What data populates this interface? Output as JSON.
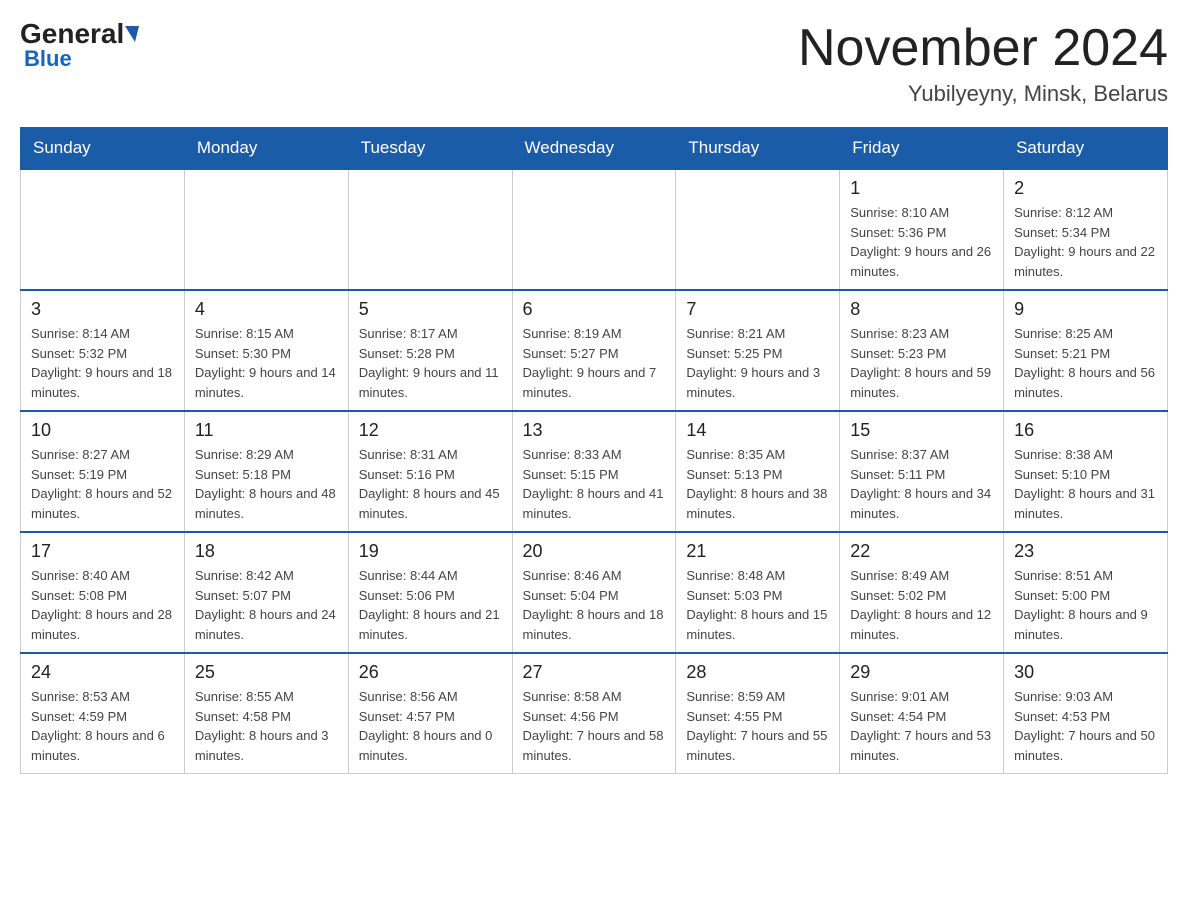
{
  "header": {
    "logo_general": "General",
    "logo_blue": "Blue",
    "month_title": "November 2024",
    "location": "Yubilyeyny, Minsk, Belarus"
  },
  "weekdays": [
    "Sunday",
    "Monday",
    "Tuesday",
    "Wednesday",
    "Thursday",
    "Friday",
    "Saturday"
  ],
  "weeks": [
    [
      {
        "day": "",
        "info": ""
      },
      {
        "day": "",
        "info": ""
      },
      {
        "day": "",
        "info": ""
      },
      {
        "day": "",
        "info": ""
      },
      {
        "day": "",
        "info": ""
      },
      {
        "day": "1",
        "info": "Sunrise: 8:10 AM\nSunset: 5:36 PM\nDaylight: 9 hours and 26 minutes."
      },
      {
        "day": "2",
        "info": "Sunrise: 8:12 AM\nSunset: 5:34 PM\nDaylight: 9 hours and 22 minutes."
      }
    ],
    [
      {
        "day": "3",
        "info": "Sunrise: 8:14 AM\nSunset: 5:32 PM\nDaylight: 9 hours and 18 minutes."
      },
      {
        "day": "4",
        "info": "Sunrise: 8:15 AM\nSunset: 5:30 PM\nDaylight: 9 hours and 14 minutes."
      },
      {
        "day": "5",
        "info": "Sunrise: 8:17 AM\nSunset: 5:28 PM\nDaylight: 9 hours and 11 minutes."
      },
      {
        "day": "6",
        "info": "Sunrise: 8:19 AM\nSunset: 5:27 PM\nDaylight: 9 hours and 7 minutes."
      },
      {
        "day": "7",
        "info": "Sunrise: 8:21 AM\nSunset: 5:25 PM\nDaylight: 9 hours and 3 minutes."
      },
      {
        "day": "8",
        "info": "Sunrise: 8:23 AM\nSunset: 5:23 PM\nDaylight: 8 hours and 59 minutes."
      },
      {
        "day": "9",
        "info": "Sunrise: 8:25 AM\nSunset: 5:21 PM\nDaylight: 8 hours and 56 minutes."
      }
    ],
    [
      {
        "day": "10",
        "info": "Sunrise: 8:27 AM\nSunset: 5:19 PM\nDaylight: 8 hours and 52 minutes."
      },
      {
        "day": "11",
        "info": "Sunrise: 8:29 AM\nSunset: 5:18 PM\nDaylight: 8 hours and 48 minutes."
      },
      {
        "day": "12",
        "info": "Sunrise: 8:31 AM\nSunset: 5:16 PM\nDaylight: 8 hours and 45 minutes."
      },
      {
        "day": "13",
        "info": "Sunrise: 8:33 AM\nSunset: 5:15 PM\nDaylight: 8 hours and 41 minutes."
      },
      {
        "day": "14",
        "info": "Sunrise: 8:35 AM\nSunset: 5:13 PM\nDaylight: 8 hours and 38 minutes."
      },
      {
        "day": "15",
        "info": "Sunrise: 8:37 AM\nSunset: 5:11 PM\nDaylight: 8 hours and 34 minutes."
      },
      {
        "day": "16",
        "info": "Sunrise: 8:38 AM\nSunset: 5:10 PM\nDaylight: 8 hours and 31 minutes."
      }
    ],
    [
      {
        "day": "17",
        "info": "Sunrise: 8:40 AM\nSunset: 5:08 PM\nDaylight: 8 hours and 28 minutes."
      },
      {
        "day": "18",
        "info": "Sunrise: 8:42 AM\nSunset: 5:07 PM\nDaylight: 8 hours and 24 minutes."
      },
      {
        "day": "19",
        "info": "Sunrise: 8:44 AM\nSunset: 5:06 PM\nDaylight: 8 hours and 21 minutes."
      },
      {
        "day": "20",
        "info": "Sunrise: 8:46 AM\nSunset: 5:04 PM\nDaylight: 8 hours and 18 minutes."
      },
      {
        "day": "21",
        "info": "Sunrise: 8:48 AM\nSunset: 5:03 PM\nDaylight: 8 hours and 15 minutes."
      },
      {
        "day": "22",
        "info": "Sunrise: 8:49 AM\nSunset: 5:02 PM\nDaylight: 8 hours and 12 minutes."
      },
      {
        "day": "23",
        "info": "Sunrise: 8:51 AM\nSunset: 5:00 PM\nDaylight: 8 hours and 9 minutes."
      }
    ],
    [
      {
        "day": "24",
        "info": "Sunrise: 8:53 AM\nSunset: 4:59 PM\nDaylight: 8 hours and 6 minutes."
      },
      {
        "day": "25",
        "info": "Sunrise: 8:55 AM\nSunset: 4:58 PM\nDaylight: 8 hours and 3 minutes."
      },
      {
        "day": "26",
        "info": "Sunrise: 8:56 AM\nSunset: 4:57 PM\nDaylight: 8 hours and 0 minutes."
      },
      {
        "day": "27",
        "info": "Sunrise: 8:58 AM\nSunset: 4:56 PM\nDaylight: 7 hours and 58 minutes."
      },
      {
        "day": "28",
        "info": "Sunrise: 8:59 AM\nSunset: 4:55 PM\nDaylight: 7 hours and 55 minutes."
      },
      {
        "day": "29",
        "info": "Sunrise: 9:01 AM\nSunset: 4:54 PM\nDaylight: 7 hours and 53 minutes."
      },
      {
        "day": "30",
        "info": "Sunrise: 9:03 AM\nSunset: 4:53 PM\nDaylight: 7 hours and 50 minutes."
      }
    ]
  ]
}
